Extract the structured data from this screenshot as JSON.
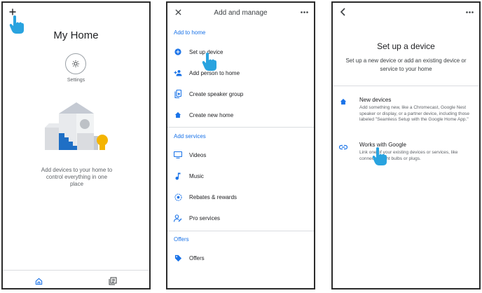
{
  "panel1": {
    "title": "My Home",
    "settings_label": "Settings",
    "empty_state_text": "Add devices to your home to control everything in one place",
    "icons": [
      "plus-icon",
      "gear-icon",
      "home-icon",
      "feed-icon",
      "hand-cursor-icon"
    ]
  },
  "panel2": {
    "header_title": "Add and manage",
    "sections": [
      {
        "heading": "Add to home",
        "items": [
          {
            "label": "Set up device",
            "icon": "add-circle-icon"
          },
          {
            "label": "Add person to home",
            "icon": "person-add-icon"
          },
          {
            "label": "Create speaker group",
            "icon": "speaker-group-icon"
          },
          {
            "label": "Create new home",
            "icon": "home-icon"
          }
        ]
      },
      {
        "heading": "Add services",
        "items": [
          {
            "label": "Videos",
            "icon": "tv-icon"
          },
          {
            "label": "Music",
            "icon": "music-note-icon"
          },
          {
            "label": "Rebates & rewards",
            "icon": "rebate-icon"
          },
          {
            "label": "Pro services",
            "icon": "pro-services-icon"
          }
        ]
      },
      {
        "heading": "Offers",
        "items": [
          {
            "label": "Offers",
            "icon": "tag-icon"
          }
        ]
      }
    ]
  },
  "panel3": {
    "title": "Set up a device",
    "subtitle": "Set up a new device or add an existing device or service to your home",
    "options": [
      {
        "title": "New devices",
        "description": "Add something new, like a Chromecast, Google Nest speaker or display, or a partner device, including those labeled \"Seamless Setup with the Google Home App.\"",
        "icon": "home-icon"
      },
      {
        "title": "Works with Google",
        "description": "Link one of your existing devices or services, like connected light bulbs or plugs.",
        "icon": "link-icon"
      }
    ]
  },
  "colors": {
    "accent": "#1a73e8",
    "cursor_blue": "#29a3df",
    "text": "#202124",
    "muted": "#5f6368",
    "divider": "#dadce0"
  }
}
